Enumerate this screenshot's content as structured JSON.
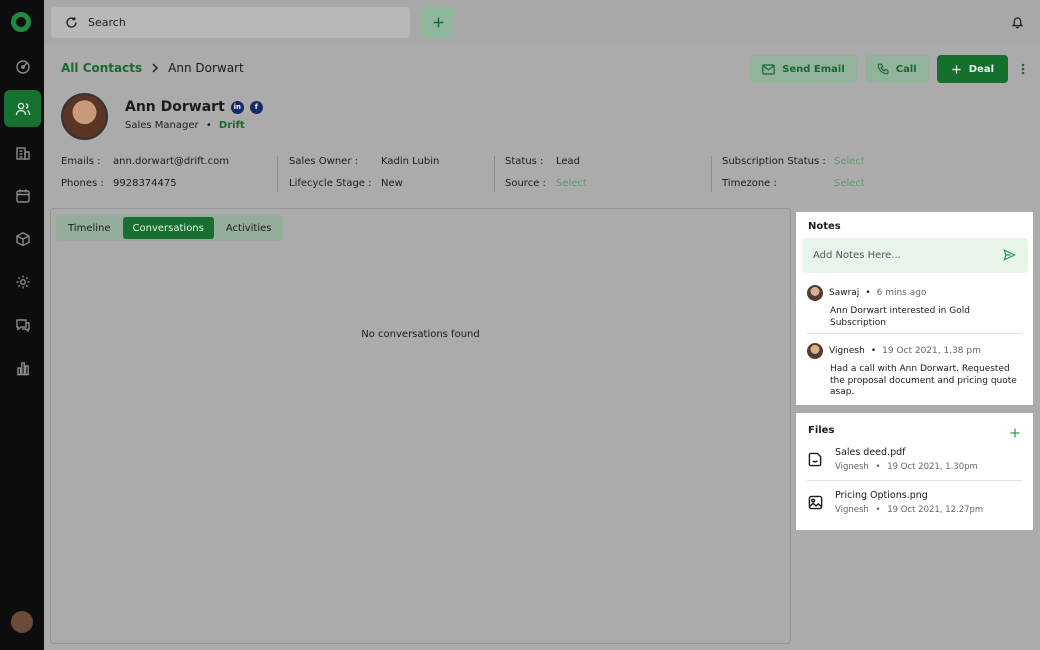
{
  "topbar": {
    "search_placeholder": "Search"
  },
  "breadcrumb": {
    "parent": "All Contacts",
    "current": "Ann Dorwart"
  },
  "actions": {
    "send_email": "Send Email",
    "call": "Call",
    "deal": "Deal"
  },
  "profile": {
    "name": "Ann Dorwart",
    "title": "Sales Manager",
    "separator": "•",
    "company": "Drift",
    "social": [
      "in",
      "f"
    ]
  },
  "details": {
    "emails_label": "Emails :",
    "emails_value": "ann.dorwart@drift.com",
    "phones_label": "Phones :",
    "phones_value": "9928374475",
    "owner_label": "Sales Owner :",
    "owner_value": "Kadin Lubin",
    "lifecycle_label": "Lifecycle Stage :",
    "lifecycle_value": "New",
    "status_label": "Status :",
    "status_value": "Lead",
    "source_label": "Source :",
    "source_value": "Select",
    "subscription_label": "Subscription Status :",
    "subscription_value": "Select",
    "timezone_label": "Timezone :",
    "timezone_value": "Select"
  },
  "tabs": [
    {
      "label": "Timeline"
    },
    {
      "label": "Conversations",
      "active": true
    },
    {
      "label": "Activities"
    }
  ],
  "conversations": {
    "empty_message": "No conversations found"
  },
  "notes": {
    "title": "Notes",
    "input_placeholder": "Add Notes Here...",
    "items": [
      {
        "author": "Sawraj",
        "time": "6 mins ago",
        "text": "Ann Dorwart interested in Gold Subscription"
      },
      {
        "author": "Vignesh",
        "time": "19 Oct 2021, 1.38 pm",
        "text": "Had a call with Ann Dorwart. Requested the proposal document and pricing quote asap."
      }
    ]
  },
  "files": {
    "title": "Files",
    "items": [
      {
        "name": "Sales deed.pdf",
        "author": "Vignesh",
        "time": "19 Oct 2021, 1.30pm"
      },
      {
        "name": "Pricing Options.png",
        "author": "Vignesh",
        "time": "19 Oct 2021, 12.27pm"
      }
    ]
  },
  "colors": {
    "brand_green": "#16702f",
    "link_green": "#1a6a30",
    "overlay_gray": "#ababab",
    "sidebar": "#0d0d0d"
  },
  "icons": [
    "refresh-icon",
    "plus-icon",
    "bell-icon",
    "mail-icon",
    "phone-icon",
    "kebab-icon",
    "send-icon",
    "file-icon",
    "image-icon"
  ]
}
